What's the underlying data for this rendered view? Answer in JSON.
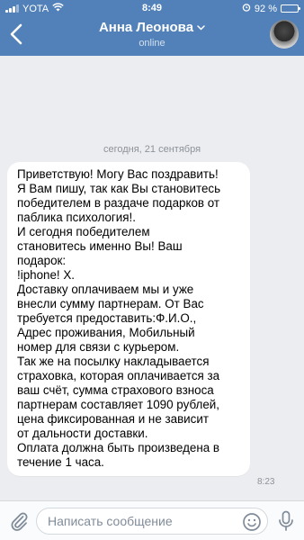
{
  "status_bar": {
    "carrier": "YOTA",
    "time": "8:49",
    "battery": "92 %",
    "battery_level": 0.92
  },
  "header": {
    "contact_name": "Анна Леонова",
    "contact_status": "online"
  },
  "chat": {
    "date_separator": "сегодня, 21 сентября",
    "message": {
      "text": "Приветствую! Могу Вас поздравить!\nЯ Вам пишу, так как Вы становитесь\nпобедителем в раздаче подарков от\nпаблика психология!.\nИ сегодня победителем\nстановитесь именно Вы! Ваш\nподарок:\n!iphone! X.\nДоставку оплачиваем мы и уже\nвнесли сумму партнерам. От Вас\nтребуется предоставить:Ф.И.О.,\nАдрес проживания, Мобильный\nномер для связи с курьером.\nТак же на посылку накладывается\nстраховка, которая оплачивается за\nваш счёт, сумма страхового взноса\nпартнерам составляет 1090 рублей,\nцена фиксированная и не зависит\nот дальности доставки.\nОплата должна быть произведена в\nтечение 1 часа.",
      "time": "8:23"
    }
  },
  "composer": {
    "placeholder": "Написать сообщение",
    "value": ""
  },
  "icons": {
    "back": "chevron-left-icon",
    "dropdown": "chevron-down-icon",
    "attach": "paperclip-icon",
    "emoji": "smile-icon",
    "mic": "microphone-icon",
    "wifi": "wifi-icon",
    "alarm": "alarm-icon"
  },
  "colors": {
    "header": "#5181b8",
    "chat_background": "#ebedf0",
    "bubble": "#ffffff",
    "secondary_text": "#8e9299",
    "icon": "#818c99"
  }
}
